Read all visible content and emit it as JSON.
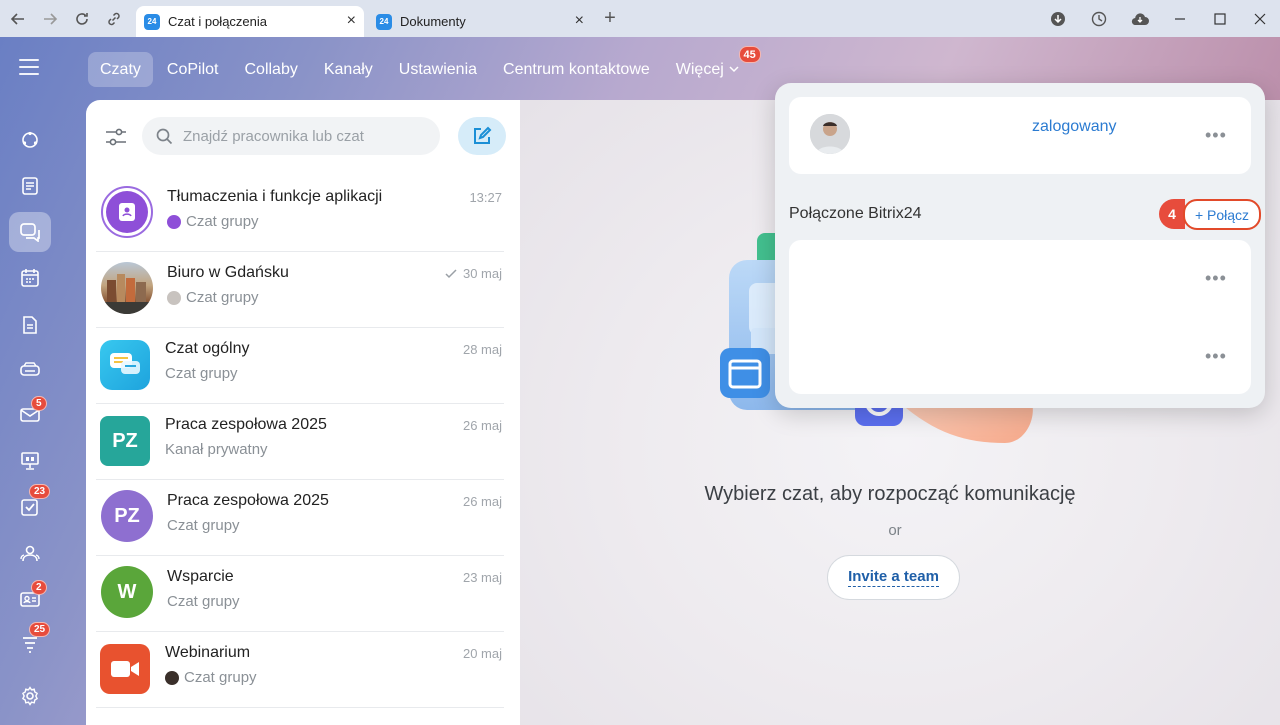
{
  "browser": {
    "tabs": [
      {
        "favicon": "24",
        "title": "Czat i połączenia",
        "active": true
      },
      {
        "favicon": "24",
        "title": "Dokumenty",
        "active": false
      }
    ]
  },
  "rail": {
    "badges": {
      "mail": "5",
      "tasks": "23",
      "contacts": "2",
      "flow": "25"
    }
  },
  "topnav": {
    "items": [
      "Czaty",
      "CoPilot",
      "Collaby",
      "Kanały",
      "Ustawienia",
      "Centrum kontaktowe",
      "Więcej"
    ],
    "more_badge": "45"
  },
  "search": {
    "placeholder": "Znajdź pracownika lub czat"
  },
  "chats": [
    {
      "title": "Tłumaczenia i funkcje aplikacji",
      "subtitle": "Czat grupy",
      "time": "13:27",
      "avatar_color": "#8e4fd8"
    },
    {
      "title": "Biuro w Gdańsku",
      "subtitle": "Czat grupy",
      "time": "30 maj",
      "avatar_color": "#a38a6c"
    },
    {
      "title": "Czat ogólny",
      "subtitle": "Czat grupy",
      "time": "28 maj",
      "avatar_color": "#27b5e8"
    },
    {
      "title": "Praca zespołowa 2025",
      "subtitle": "Kanał prywatny",
      "time": "26 maj",
      "initials": "PZ",
      "avatar_color": "#26a69a"
    },
    {
      "title": "Praca zespołowa 2025",
      "subtitle": "Czat grupy",
      "time": "26 maj",
      "initials": "PZ",
      "avatar_color": "#8e6fd0"
    },
    {
      "title": "Wsparcie",
      "subtitle": "Czat grupy",
      "time": "23 maj",
      "initials": "W",
      "avatar_color": "#5aa63a"
    },
    {
      "title": "Webinarium",
      "subtitle": "Czat grupy",
      "time": "20 maj",
      "avatar_color": "#e8522f"
    }
  ],
  "empty_state": {
    "title": "Wybierz czat, aby rozpocząć komunikację",
    "or": "or",
    "invite": "Invite a team"
  },
  "popup": {
    "status": "zalogowany",
    "section_label": "Połączone Bitrix24",
    "step_number": "4",
    "connect_label": "+ Połącz"
  }
}
